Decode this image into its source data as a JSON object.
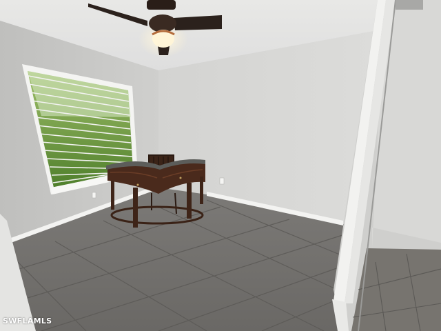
{
  "photo": {
    "scene": "empty-room-with-desk",
    "watermark": "SWFLAMLS"
  },
  "colors": {
    "wall_left": "#c9c9c7",
    "wall_back": "#d6d6d4",
    "ceiling": "#e4e4e2",
    "floor": "#6e6c6a",
    "grout": "#5a5856",
    "baseboard": "#f2f2f0",
    "desk_wood": "#4a2a1c",
    "desk_top": "#5a5b58",
    "window_green": "#6f9a3e",
    "light_glow": "#fff2cf"
  }
}
